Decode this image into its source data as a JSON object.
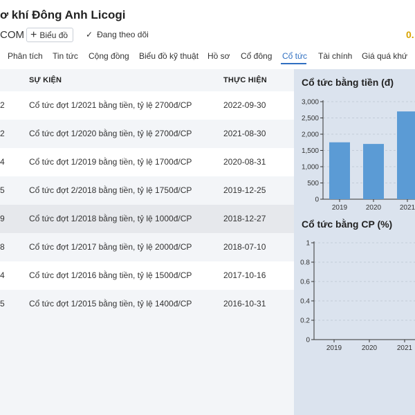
{
  "header": {
    "company_name": "ơ khí Đông Anh Licogi",
    "ticker": "COM",
    "chart_button": "Biểu đồ",
    "follow_label": "Đang theo dõi",
    "price": "0."
  },
  "tabs": [
    {
      "label": "Phân tích"
    },
    {
      "label": "Tin tức"
    },
    {
      "label": "Cộng đồng"
    },
    {
      "label": "Biểu đồ kỹ thuật"
    },
    {
      "label": "Hồ sơ"
    },
    {
      "label": "Cổ đông"
    },
    {
      "label": "Cổ tức",
      "active": true
    },
    {
      "label": "Tài chính"
    },
    {
      "label": "Giá quá khứ"
    }
  ],
  "table": {
    "headers": [
      "SỰ KIỆN",
      "THỰC HIỆN"
    ],
    "rows": [
      {
        "c0": "2",
        "event": "Cổ tức đợt 1/2021 bằng tiền, tỷ lệ 2700đ/CP",
        "date": "2022-09-30"
      },
      {
        "c0": "2",
        "event": "Cổ tức đợt 1/2020 bằng tiền, tỷ lệ 2700đ/CP",
        "date": "2021-08-30"
      },
      {
        "c0": "4",
        "event": "Cổ tức đợt 1/2019 bằng tiền, tỷ lệ 1700đ/CP",
        "date": "2020-08-31"
      },
      {
        "c0": "5",
        "event": "Cổ tức đợt 2/2018 bằng tiền, tỷ lệ 1750đ/CP",
        "date": "2019-12-25"
      },
      {
        "c0": "9",
        "event": "Cổ tức đợt 1/2018 bằng tiền, tỷ lệ 1000đ/CP",
        "date": "2018-12-27"
      },
      {
        "c0": "8",
        "event": "Cổ tức đợt 1/2017 bằng tiền, tỷ lệ 2000đ/CP",
        "date": "2018-07-10"
      },
      {
        "c0": "4",
        "event": "Cổ tức đợt 1/2016 bằng tiền, tỷ lệ 1500đ/CP",
        "date": "2017-10-16"
      },
      {
        "c0": "5",
        "event": "Cổ tức đợt 1/2015 bằng tiền, tỷ lệ 1400đ/CP",
        "date": "2016-10-31"
      }
    ]
  },
  "chart_data": [
    {
      "type": "bar",
      "title": "Cổ tức bằng tiền (đ)",
      "categories": [
        "2019",
        "2020",
        "2021"
      ],
      "values": [
        1750,
        1700,
        2700
      ],
      "yticks": [
        "0",
        "500",
        "1,000",
        "1,500",
        "2,000",
        "2,500",
        "3,000"
      ],
      "ylim": [
        0,
        3000
      ],
      "bar_color": "#5b9bd5"
    },
    {
      "type": "bar",
      "title": "Cổ tức bằng CP (%)",
      "categories": [
        "2019",
        "2020",
        "2021"
      ],
      "values": [],
      "yticks": [
        "0",
        "0.2",
        "0.4",
        "0.6",
        "0.8",
        "1"
      ],
      "ylim": [
        0,
        1
      ]
    }
  ],
  "colors": {
    "accent": "#2f6fc1",
    "price": "#d9a400",
    "panel_bg": "#dbe3ee",
    "table_bg": "#f3f5f8"
  }
}
